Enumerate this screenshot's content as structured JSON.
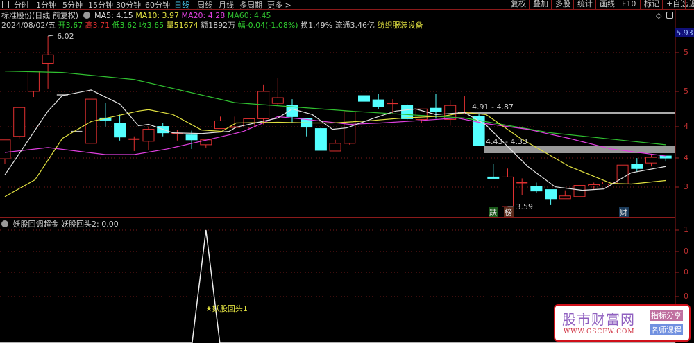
{
  "period_tabs": [
    "分时",
    "1分钟",
    "5分钟",
    "15分钟",
    "30分钟",
    "60分钟",
    "日线",
    "周线",
    "月线",
    "多周期",
    "更多 >"
  ],
  "active_tab": "日线",
  "toolbar": [
    "复权",
    "叠加",
    "多股",
    "统计",
    "画线",
    "F10",
    "标记",
    "+自选",
    "返"
  ],
  "header": {
    "name": "标准股份(日线 前复权)",
    "ma5": "MA5: 4.15",
    "ma10": "MA10: 3.97",
    "ma20": "MA20: 4.28",
    "ma60": "MA60: 4.45"
  },
  "quote": {
    "date": "2024/08/02/五",
    "open": "开3.67",
    "high": "高3.71",
    "low": "低3.62",
    "close": "收3.65",
    "vol": "量51674",
    "amount": "额1892万",
    "change": "幅-0.04(-1.08%)",
    "turnover": "换1.49%",
    "float": "流通3.46亿",
    "industry": "纺织服装设备"
  },
  "price_label": "5.93",
  "axis_labels": [
    "5",
    "5",
    "4",
    "4",
    "3"
  ],
  "sub_axis_labels": [
    "1",
    "0",
    "0",
    "0"
  ],
  "annotations": {
    "high": "6.02",
    "low": "3.59",
    "band1": "4.91 - 4.87",
    "band2": "4.43 - 4.33",
    "mark_die": "跌",
    "mark_bang": "榜",
    "mark_cai": "财"
  },
  "indicator": {
    "name": "妖股回调超金",
    "value": "妖股回头2: 0.00",
    "signal_label": "★妖股回头1"
  },
  "logo": {
    "name": "股市财富网",
    "url": "WWW.GSCFW.COM",
    "tag1": "指标分享",
    "tag2": "名师课程"
  },
  "colors": {
    "up": "#e03030",
    "down": "#54ffff",
    "ma5": "#e0e0e0",
    "ma10": "#e0e040",
    "ma20": "#e040e0",
    "ma60": "#30c030"
  },
  "chart_data": {
    "type": "candlestick",
    "candles": [
      [
        4.27,
        4.54,
        4.54,
        4.2
      ],
      [
        4.59,
        5.0,
        5.0,
        4.56
      ],
      [
        5.23,
        5.52,
        5.52,
        5.15
      ],
      [
        5.63,
        5.75,
        6.02,
        5.27
      ],
      [
        5.18,
        5.18,
        5.18,
        5.18
      ],
      [
        4.66,
        4.66,
        4.66,
        4.66
      ],
      [
        4.49,
        5.12,
        5.12,
        4.49
      ],
      [
        4.85,
        4.82,
        5.07,
        4.73
      ],
      [
        4.77,
        4.58,
        4.9,
        4.53
      ],
      [
        4.55,
        4.55,
        4.59,
        4.38
      ],
      [
        4.52,
        4.69,
        4.73,
        4.39
      ],
      [
        4.73,
        4.64,
        4.78,
        4.59
      ],
      [
        4.63,
        4.63,
        4.68,
        4.53
      ],
      [
        4.61,
        4.54,
        4.67,
        4.41
      ],
      [
        4.47,
        4.54,
        4.54,
        4.43
      ],
      [
        4.7,
        4.81,
        4.87,
        4.7
      ],
      [
        4.72,
        4.72,
        4.87,
        4.7
      ],
      [
        4.72,
        4.84,
        4.84,
        4.7
      ],
      [
        4.84,
        5.23,
        5.33,
        4.76
      ],
      [
        5.06,
        5.14,
        5.42,
        5.04
      ],
      [
        5.03,
        4.87,
        5.12,
        4.78
      ],
      [
        4.84,
        4.72,
        4.84,
        4.59
      ],
      [
        4.7,
        4.39,
        4.72,
        4.39
      ],
      [
        4.38,
        4.49,
        4.54,
        4.38
      ],
      [
        4.49,
        4.94,
        4.94,
        4.47
      ],
      [
        5.17,
        5.09,
        5.32,
        5.02
      ],
      [
        5.11,
        5.01,
        5.19,
        4.98
      ],
      [
        5.06,
        5.06,
        5.12,
        4.92
      ],
      [
        5.03,
        4.84,
        5.05,
        4.82
      ],
      [
        4.83,
        4.98,
        4.98,
        4.78
      ],
      [
        4.99,
        4.94,
        5.19,
        4.84
      ],
      [
        4.83,
        5.03,
        5.1,
        4.74
      ],
      [
        4.93,
        4.93,
        5.16,
        4.91
      ],
      [
        4.87,
        4.46,
        4.91,
        4.46
      ],
      [
        4.01,
        3.99,
        4.2,
        3.99
      ],
      [
        3.59,
        4.01,
        4.13,
        3.59
      ],
      [
        3.93,
        3.93,
        3.99,
        3.75
      ],
      [
        3.88,
        3.81,
        3.93,
        3.78
      ],
      [
        3.83,
        3.7,
        3.83,
        3.61
      ],
      [
        3.7,
        3.74,
        3.82,
        3.7
      ],
      [
        3.73,
        3.89,
        3.89,
        3.73
      ],
      [
        3.88,
        3.9,
        3.93,
        3.83
      ],
      [
        3.91,
        3.94,
        3.94,
        3.89
      ],
      [
        3.91,
        4.18,
        4.18,
        3.91
      ],
      [
        4.19,
        4.13,
        4.28,
        4.08
      ],
      [
        4.21,
        4.29,
        4.33,
        4.16
      ],
      [
        4.31,
        4.28,
        4.31,
        4.23
      ]
    ],
    "ma5": [
      [
        0,
        4.04
      ],
      [
        3,
        4.95
      ],
      [
        4,
        5.17
      ],
      [
        6,
        5.25
      ],
      [
        8,
        5.05
      ],
      [
        9.3,
        4.74
      ],
      [
        10,
        4.76
      ],
      [
        11.7,
        4.64
      ],
      [
        13.7,
        4.63
      ],
      [
        15.6,
        4.66
      ],
      [
        16.1,
        4.72
      ],
      [
        19,
        4.85
      ],
      [
        20,
        4.98
      ],
      [
        21.4,
        4.9
      ],
      [
        22.8,
        4.69
      ],
      [
        23.8,
        4.71
      ],
      [
        25.7,
        4.85
      ],
      [
        27.2,
        4.95
      ],
      [
        28.6,
        4.98
      ],
      [
        30,
        4.9
      ],
      [
        32,
        4.93
      ],
      [
        33.5,
        4.75
      ],
      [
        36.4,
        4.16
      ],
      [
        38.3,
        3.87
      ],
      [
        40.2,
        3.82
      ],
      [
        41.7,
        3.84
      ],
      [
        43.6,
        4.07
      ],
      [
        46,
        4.16
      ]
    ],
    "ma10": [
      [
        0,
        3.73
      ],
      [
        2.1,
        3.97
      ],
      [
        4,
        4.56
      ],
      [
        6,
        4.8
      ],
      [
        9.3,
        4.95
      ],
      [
        10,
        4.97
      ],
      [
        11.7,
        4.9
      ],
      [
        13.7,
        4.68
      ],
      [
        15.1,
        4.66
      ],
      [
        16.1,
        4.78
      ],
      [
        19,
        4.79
      ],
      [
        21.4,
        4.78
      ],
      [
        22.8,
        4.78
      ],
      [
        25.3,
        4.81
      ],
      [
        27.7,
        4.85
      ],
      [
        30.6,
        4.88
      ],
      [
        32,
        4.93
      ],
      [
        33.5,
        4.9
      ],
      [
        35.9,
        4.56
      ],
      [
        39.3,
        4.16
      ],
      [
        42.2,
        3.92
      ],
      [
        43.6,
        3.91
      ],
      [
        46,
        3.96
      ]
    ],
    "ma20": [
      [
        0,
        4.36
      ],
      [
        3,
        4.43
      ],
      [
        7,
        4.33
      ],
      [
        9,
        4.33
      ],
      [
        11.3,
        4.41
      ],
      [
        15.6,
        4.61
      ],
      [
        16.6,
        4.66
      ],
      [
        19,
        4.87
      ],
      [
        21,
        4.83
      ],
      [
        24,
        4.76
      ],
      [
        26.2,
        4.78
      ],
      [
        28.6,
        4.81
      ],
      [
        31.5,
        4.85
      ],
      [
        33.5,
        4.77
      ],
      [
        36.4,
        4.69
      ],
      [
        39.3,
        4.56
      ],
      [
        42.2,
        4.41
      ],
      [
        46,
        4.31
      ]
    ],
    "ma60": [
      [
        0,
        5.52
      ],
      [
        4,
        5.5
      ],
      [
        9,
        5.4
      ],
      [
        16,
        5.07
      ],
      [
        24,
        4.95
      ],
      [
        32,
        4.85
      ],
      [
        38,
        4.64
      ],
      [
        46,
        4.47
      ]
    ],
    "indicator_series": {
      "spike_index": 14,
      "spike_value": 1,
      "baseline": 0
    },
    "price_range": [
      3.4,
      6.05
    ]
  }
}
